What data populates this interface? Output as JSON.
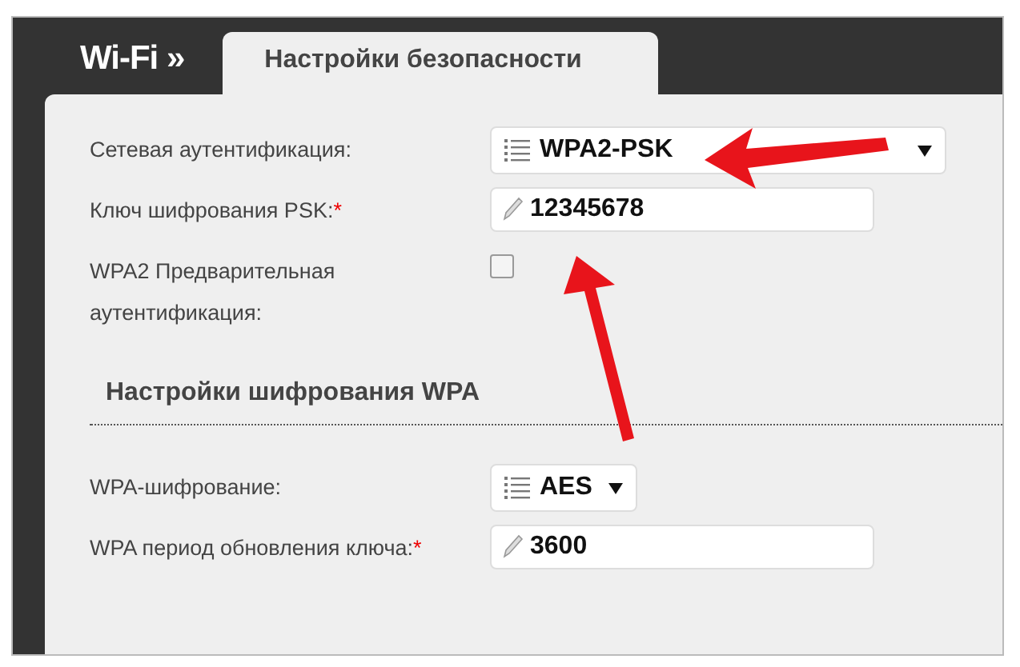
{
  "header": {
    "title": "Wi-Fi »",
    "tabs": [
      {
        "label": "Настройки безопасности",
        "selected": true
      }
    ]
  },
  "security_fields": [
    {
      "kind": "select",
      "label": "Сетевая аутентификация:",
      "value": "WPA2-PSK",
      "wide": true
    },
    {
      "kind": "text",
      "label": "Ключ шифрования PSK:",
      "required_mark": "*",
      "value": "12345678"
    },
    {
      "kind": "checkbox",
      "label": "WPA2 Предварительная аутентификация:",
      "checked": false
    }
  ],
  "wpa_section": {
    "heading": "Настройки шифрования WPA",
    "fields": [
      {
        "kind": "select",
        "label": "WPA-шифрование:",
        "value": "AES",
        "wide": false
      },
      {
        "kind": "text",
        "label": "WPA период обновления ключа:",
        "required_mark": "*",
        "value": "3600"
      }
    ]
  }
}
